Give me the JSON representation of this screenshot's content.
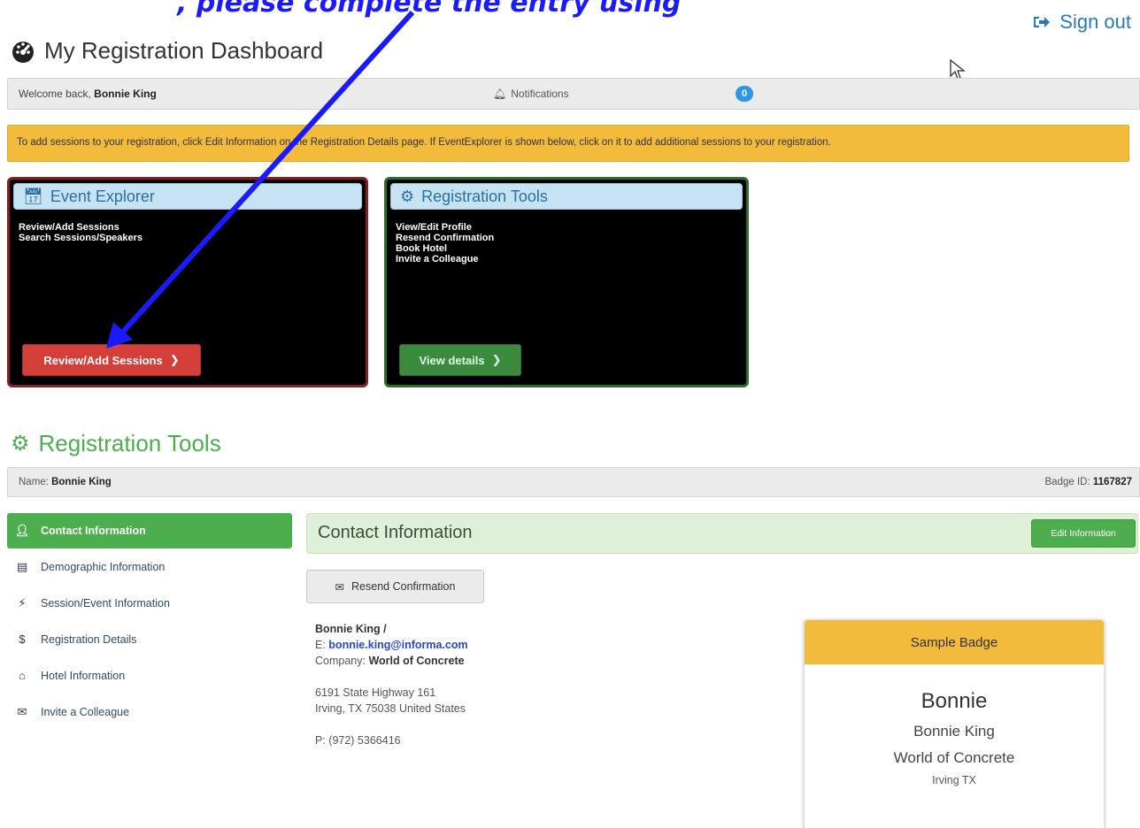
{
  "caption": ", please complete the entry using",
  "header": {
    "signout_label": "Sign out",
    "title": "My Registration Dashboard"
  },
  "welcome": {
    "prefix": "Welcome back, ",
    "name": "Bonnie King",
    "notifications_label": "Notifications",
    "notifications_count": "0"
  },
  "alert": {
    "text": "To add sessions to your registration, click Edit Information on the Registration Details page. If EventExplorer is shown below, click on it to add additional sessions to your registration."
  },
  "tiles": {
    "event_explorer": {
      "title": "Event Explorer",
      "items": [
        "Review/Add Sessions",
        "Search Sessions/Speakers"
      ],
      "button": "Review/Add Sessions"
    },
    "registration_tools": {
      "title": "Registration Tools",
      "items": [
        "View/Edit Profile",
        "Resend Confirmation",
        "Book Hotel",
        "Invite a Colleague"
      ],
      "button": "View details"
    }
  },
  "section": {
    "title": "Registration Tools",
    "name_label": "Name: ",
    "name_value": "Bonnie King",
    "badge_label": "Badge ID: ",
    "badge_value": "1167827"
  },
  "sidenav": [
    {
      "label": "Contact Information",
      "icon": "user-icon"
    },
    {
      "label": "Demographic Information",
      "icon": "id-card-icon"
    },
    {
      "label": "Session/Event Information",
      "icon": "bolt-icon"
    },
    {
      "label": "Registration Details",
      "icon": "dollar-icon"
    },
    {
      "label": "Hotel Information",
      "icon": "home-icon"
    },
    {
      "label": "Invite a Colleague",
      "icon": "envelope-icon"
    }
  ],
  "contact": {
    "panel_title": "Contact Information",
    "edit_button": "Edit Information",
    "resend_button": "Resend Confirmation",
    "name_line": "Bonnie King /",
    "email_label": "E: ",
    "email": "bonnie.king@informa.com",
    "company_label": "Company: ",
    "company": "World of Concrete",
    "address1": "6191 State Highway 161",
    "address2": "Irving, TX 75038 United States",
    "phone": "P: (972) 5366416"
  },
  "badge": {
    "title": "Sample Badge",
    "first_name": "Bonnie",
    "full_name": "Bonnie King",
    "company": "World of Concrete",
    "city": "Irving TX"
  },
  "colors": {
    "accent_green": "#4cae4c",
    "alert_yellow": "#f2bb3c",
    "danger_red": "#d43f3a",
    "link_blue": "#2a7ab8",
    "arrow_blue": "#1a1aff"
  }
}
